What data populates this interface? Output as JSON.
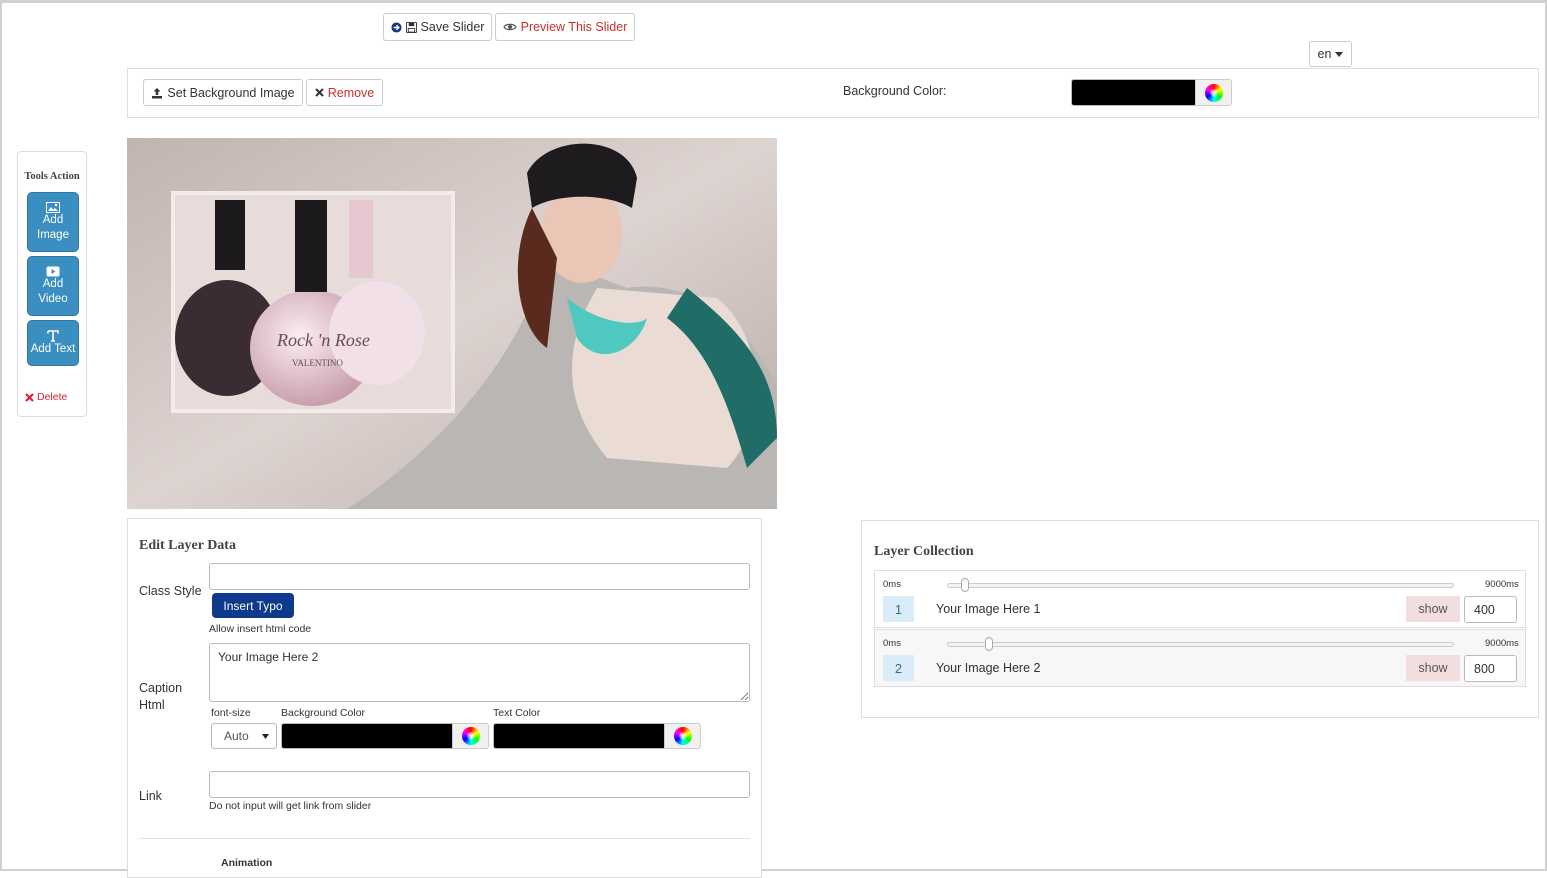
{
  "toolbar": {
    "save_label": "Save Slider",
    "preview_label": "Preview This Slider",
    "language": "en"
  },
  "background_bar": {
    "set_image_label": "Set Background Image",
    "remove_label": "Remove",
    "bg_color_label": "Background Color:",
    "bg_color_value": "#000000"
  },
  "tools": {
    "title": "Tools Action",
    "add_image": "Add Image",
    "add_video": "Add Video",
    "add_text": "Add Text",
    "delete": "Delete"
  },
  "edit_layer": {
    "title": "Edit Layer Data",
    "class_style_label": "Class Style",
    "class_style_value": "",
    "insert_typo_label": "Insert Typo",
    "allow_html_note": "Allow insert html code",
    "caption_label": "Caption Html",
    "caption_value": "Your Image Here 2",
    "font_size_label": "font-size",
    "font_size_value": "Auto",
    "bg_color_label": "Background Color",
    "text_color_label": "Text Color",
    "link_label": "Link",
    "link_value": "",
    "link_note": "Do not input will get link from slider",
    "animation_label": "Animation"
  },
  "layer_collection": {
    "title": "Layer Collection",
    "layers": [
      {
        "number": "1",
        "name": "Your Image Here 1",
        "start_label": "0ms",
        "end_label": "9000ms",
        "show_label": "show",
        "duration": "400"
      },
      {
        "number": "2",
        "name": "Your Image Here 2",
        "start_label": "0ms",
        "end_label": "9000ms",
        "show_label": "show",
        "duration": "800"
      }
    ]
  },
  "colors": {
    "accent": "#3a8ec0",
    "insert_typo": "#0d3a8a",
    "danger": "#c9302c"
  },
  "icons": [
    "arrow-circle-right-icon",
    "floppy-disk-icon",
    "eye-icon",
    "caret-down-icon",
    "upload-icon",
    "x-icon",
    "color-wheel-icon",
    "image-icon",
    "video-icon",
    "text-icon"
  ]
}
